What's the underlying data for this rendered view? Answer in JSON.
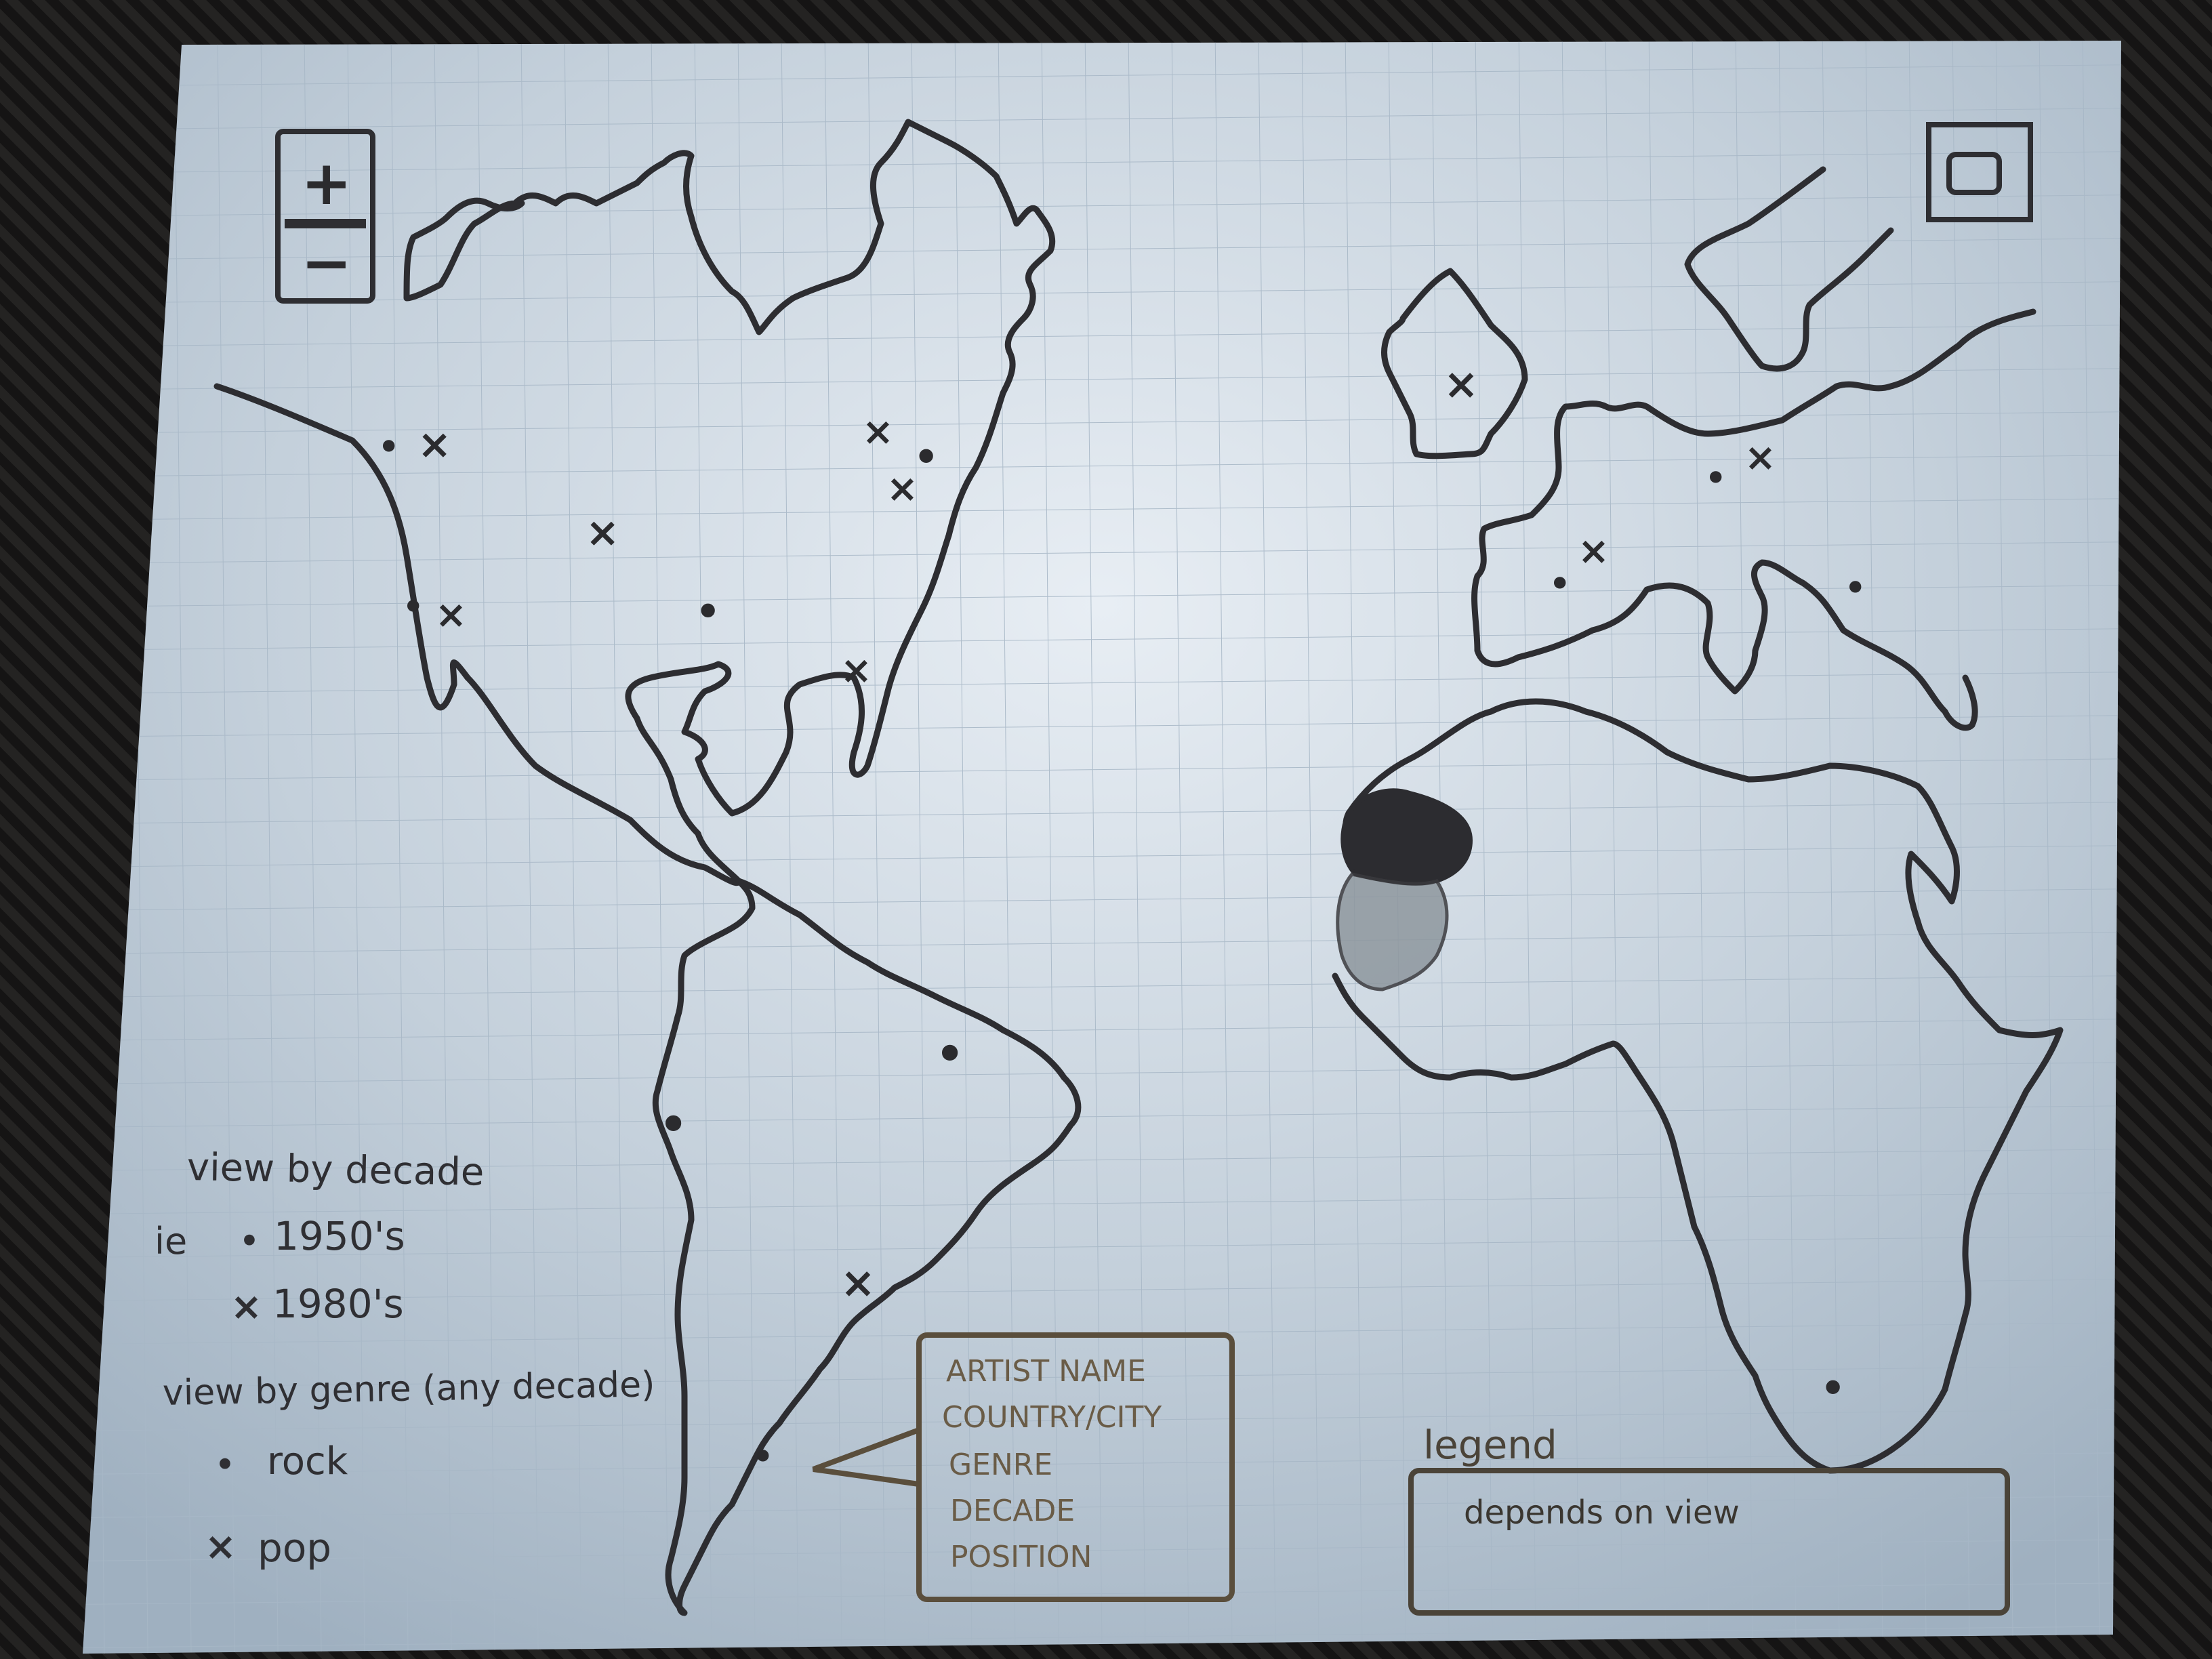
{
  "zoom": {
    "plus": "+",
    "minus": "−"
  },
  "fullscreen": {
    "icon": "fullscreen-icon"
  },
  "markers": {
    "dot": "•",
    "cross": "×"
  },
  "view_by_decade": {
    "title": "view by decade",
    "prefix": "ie",
    "items": [
      {
        "marker": "•",
        "label": "1950's"
      },
      {
        "marker": "×",
        "label": "1980's"
      }
    ]
  },
  "view_by_genre": {
    "title": "view by genre (any decade)",
    "items": [
      {
        "marker": "•",
        "label": "rock"
      },
      {
        "marker": "×",
        "label": "pop"
      }
    ]
  },
  "popup": {
    "lines": [
      "ARTIST NAME",
      "COUNTRY/CITY",
      "GENRE",
      "DECADE",
      "POSITION"
    ]
  },
  "legend": {
    "title": "legend",
    "body": "depends on view"
  },
  "colors": {
    "paper": "#c7d2db",
    "ink": "#2e2e32",
    "grid": "#a9b9c8"
  }
}
